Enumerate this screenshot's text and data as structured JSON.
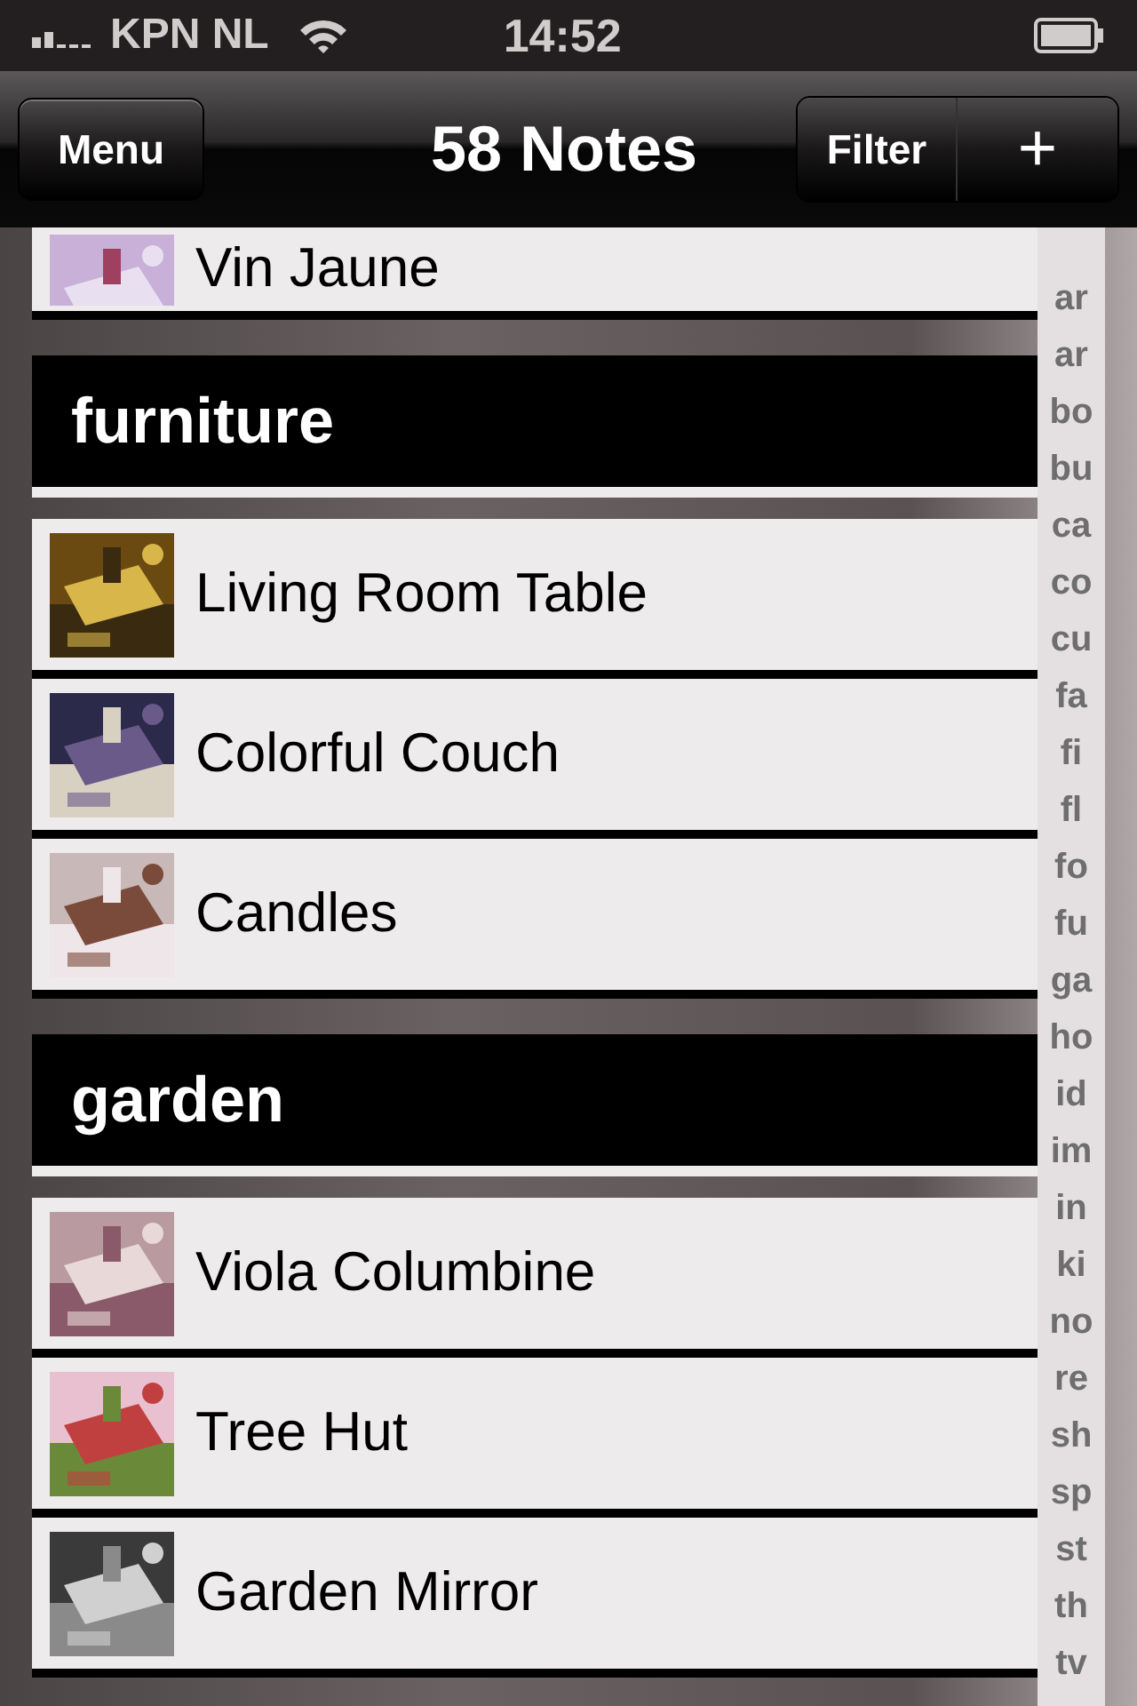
{
  "status_bar": {
    "carrier": "KPN NL",
    "time": "14:52"
  },
  "nav_bar": {
    "left_button": "Menu",
    "title": "58 Notes",
    "right_buttons": [
      "Filter",
      "+"
    ]
  },
  "notes_above": [
    {
      "title": "Vin Jaune"
    }
  ],
  "sections": [
    {
      "title": "furniture",
      "notes": [
        {
          "title": "Living Room Table"
        },
        {
          "title": "Colorful Couch"
        },
        {
          "title": "Candles"
        }
      ]
    },
    {
      "title": "garden",
      "notes": [
        {
          "title": "Viola Columbine"
        },
        {
          "title": "Tree Hut"
        },
        {
          "title": "Garden Mirror"
        }
      ]
    }
  ],
  "index": [
    "ar",
    "ar",
    "bo",
    "bu",
    "ca",
    "co",
    "cu",
    "fa",
    "fi",
    "fl",
    "fo",
    "fu",
    "ga",
    "ho",
    "id",
    "im",
    "in",
    "ki",
    "no",
    "re",
    "sh",
    "sp",
    "st",
    "th",
    "tv"
  ]
}
